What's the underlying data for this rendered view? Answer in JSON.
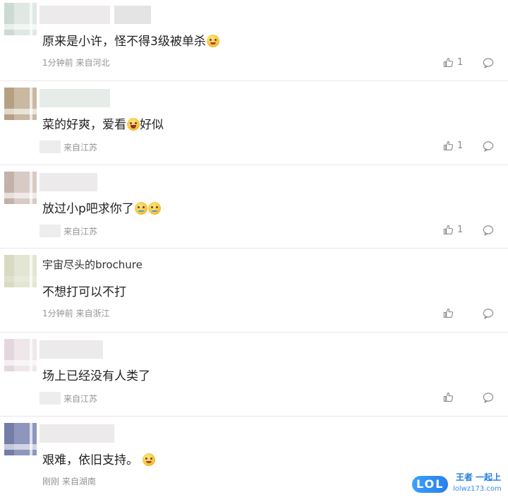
{
  "comments": [
    {
      "name": "",
      "text": "原来是小许，怪不得3级被单杀",
      "emoji": "laugh-cat-emoji",
      "meta_time": "1分钟前",
      "meta_location": "来自河北",
      "likes": "1"
    },
    {
      "name": "",
      "text_before": "菜的好爽，爱看",
      "text_after": "好似",
      "emoji": "laugh-emoji",
      "meta_location": "来自江苏",
      "likes": "1"
    },
    {
      "name": "",
      "text": "放过小p吧求你了",
      "emoji": "cry-emoji",
      "meta_location": "来自江苏",
      "likes": "1"
    },
    {
      "name": "宇宙尽头的brochure",
      "text": "不想打可以不打",
      "meta_time": "1分钟前",
      "meta_location": "来自浙江",
      "likes": ""
    },
    {
      "name": "",
      "text": "场上已经没有人类了",
      "meta_location": "来自江苏",
      "likes": ""
    },
    {
      "name": "",
      "text": "艰难，依旧支持。",
      "emoji": "smile-emoji",
      "meta_time": "刚刚",
      "meta_location": "来自湖南",
      "likes": ""
    }
  ],
  "watermark": {
    "logo": "LOL",
    "slogan": "王者 一起上",
    "url": "lolwz173.com"
  },
  "colors": {
    "meta": "#939393",
    "divider": "#e8e8e8",
    "watermark": "#1f7de0"
  }
}
